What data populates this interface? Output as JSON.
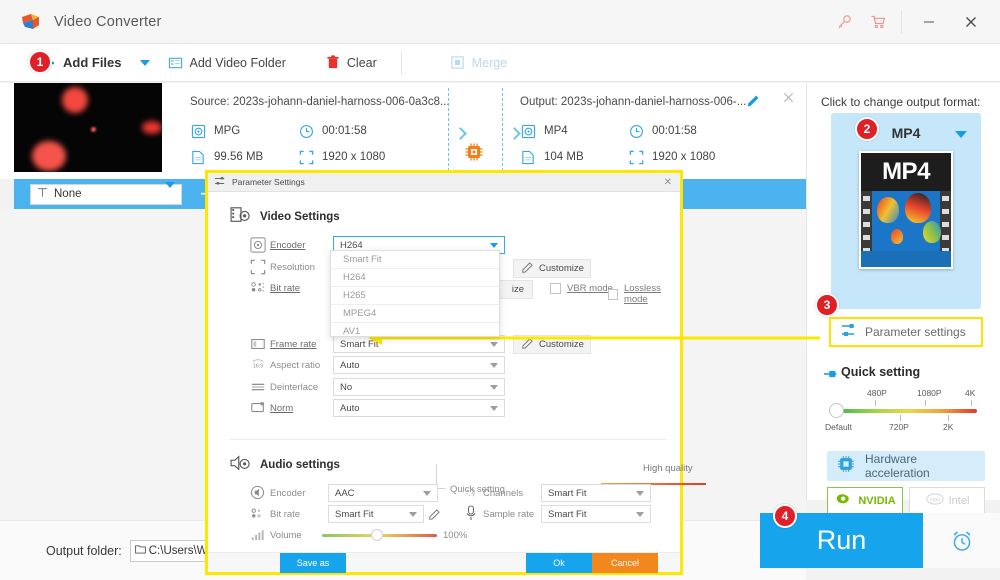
{
  "window": {
    "title": "Video Converter",
    "icons": {
      "key": "key-icon",
      "cart": "cart-icon",
      "minimize": "minimize-icon",
      "close": "close-icon"
    }
  },
  "toolbar": {
    "add_files": "Add Files",
    "add_video_folder": "Add Video Folder",
    "clear": "Clear",
    "merge": "Merge"
  },
  "file_item": {
    "source_label": "Source: 2023s-johann-daniel-harnoss-006-0a3c8...",
    "output_label": "Output: 2023s-johann-daniel-harnoss-006-...",
    "gpu_label": "GPU",
    "source": {
      "format": "MPG",
      "duration": "00:01:58",
      "size": "99.56 MB",
      "resolution": "1920 x 1080"
    },
    "output": {
      "format": "MP4",
      "duration": "00:01:58",
      "size": "104 MB",
      "resolution": "1920 x 1080"
    },
    "subtitle_select": "None"
  },
  "bottom": {
    "output_folder_label": "Output folder:",
    "output_folder_value": "C:\\Users\\WonderFox",
    "run_label": "Run"
  },
  "right_panel": {
    "heading": "Click to change output format:",
    "format_name": "MP4",
    "poster_text": "MP4",
    "parameter_settings": "Parameter settings",
    "quick_setting": "Quick setting",
    "slider": {
      "top_labels": [
        "480P",
        "1080P",
        "4K"
      ],
      "bottom_labels": [
        "Default",
        "720P",
        "2K"
      ]
    },
    "hardware_acceleration": "Hardware acceleration",
    "nvidia": "NVIDIA",
    "intel": "Intel"
  },
  "badges": {
    "one": "1",
    "two": "2",
    "three": "3",
    "four": "4"
  },
  "dialog": {
    "title": "Parameter Settings",
    "video_section": "Video Settings",
    "audio_section": "Audio settings",
    "video": {
      "encoder_label": "Encoder",
      "encoder_value": "H264",
      "encoder_options": [
        "Smart Fit",
        "H264",
        "H265",
        "MPEG4",
        "AV1"
      ],
      "resolution_label": "Resolution",
      "resolution_customize": "Customize",
      "bitrate_label": "Bit rate",
      "bitrate_customize": "ize",
      "vbr_mode": "VBR mode",
      "lossless_mode": "Lossless mode",
      "quick_setting_label": "Quick setting",
      "quality_label": "High quality",
      "framerate_label": "Frame rate",
      "framerate_value": "Smart Fit",
      "framerate_customize": "Customize",
      "aspect_label": "Aspect ratio",
      "aspect_value": "Auto",
      "deinterlace_label": "Deinterlace",
      "deinterlace_value": "No",
      "norm_label": "Norm",
      "norm_value": "Auto"
    },
    "audio": {
      "encoder_label": "Encoder",
      "encoder_value": "AAC",
      "channels_label": "Channels",
      "channels_value": "Smart Fit",
      "bitrate_label": "Bit rate",
      "bitrate_value": "Smart Fit",
      "samplerate_label": "Sample rate",
      "samplerate_value": "Smart Fit",
      "volume_label": "Volume",
      "volume_value": "100%"
    },
    "footer": {
      "save_as": "Save as",
      "ok": "Ok",
      "cancel": "Cancel"
    }
  }
}
